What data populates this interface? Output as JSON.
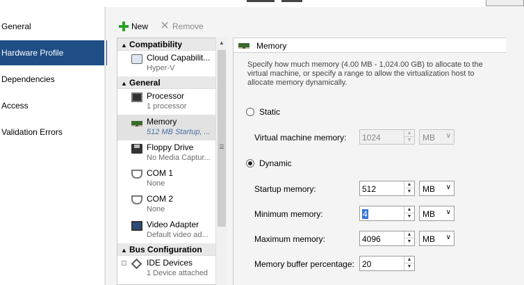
{
  "nav": {
    "items": [
      {
        "label": "General"
      },
      {
        "label": "Hardware Profile"
      },
      {
        "label": "Dependencies"
      },
      {
        "label": "Access"
      },
      {
        "label": "Validation Errors"
      }
    ]
  },
  "toolbar": {
    "new_label": "New",
    "remove_label": "Remove"
  },
  "hardware": {
    "groups": [
      {
        "label": "Compatibility"
      },
      {
        "label": "General"
      },
      {
        "label": "Bus Configuration"
      }
    ],
    "items": [
      {
        "name": "Cloud Capabilit...",
        "sub": "Hyper-V",
        "icon": "cloud-icon"
      },
      {
        "name": "Processor",
        "sub": "1 processor",
        "icon": "processor-icon"
      },
      {
        "name": "Memory",
        "sub": "512 MB Startup, ...",
        "icon": "memory-icon"
      },
      {
        "name": "Floppy Drive",
        "sub": "No Media Captur...",
        "icon": "floppy-icon"
      },
      {
        "name": "COM 1",
        "sub": "None",
        "icon": "com-port-icon"
      },
      {
        "name": "COM 2",
        "sub": "None",
        "icon": "com-port-icon"
      },
      {
        "name": "Video Adapter",
        "sub": "Default video ad...",
        "icon": "video-adapter-icon"
      },
      {
        "name": "IDE Devices",
        "sub": "1 Device attached",
        "icon": "ide-icon"
      }
    ]
  },
  "memory": {
    "title": "Memory",
    "description": "Specify how much memory (4.00 MB - 1,024.00 GB) to allocate to the virtual machine, or specify a range to allow the virtualization host to allocate memory dynamically.",
    "static_label": "Static",
    "vm_memory_label": "Virtual machine memory:",
    "vm_memory_value": "1024",
    "vm_memory_unit": "MB",
    "dynamic_label": "Dynamic",
    "startup_label": "Startup memory:",
    "startup_value": "512",
    "startup_unit": "MB",
    "minimum_label": "Minimum memory:",
    "minimum_value": "4",
    "minimum_unit": "MB",
    "maximum_label": "Maximum memory:",
    "maximum_value": "4096",
    "maximum_unit": "MB",
    "buffer_label": "Memory buffer percentage:",
    "buffer_value": "20",
    "selected_mode": "dynamic"
  },
  "colors": {
    "nav_active": "#1e4e85",
    "new_icon": "#2aa12a"
  }
}
